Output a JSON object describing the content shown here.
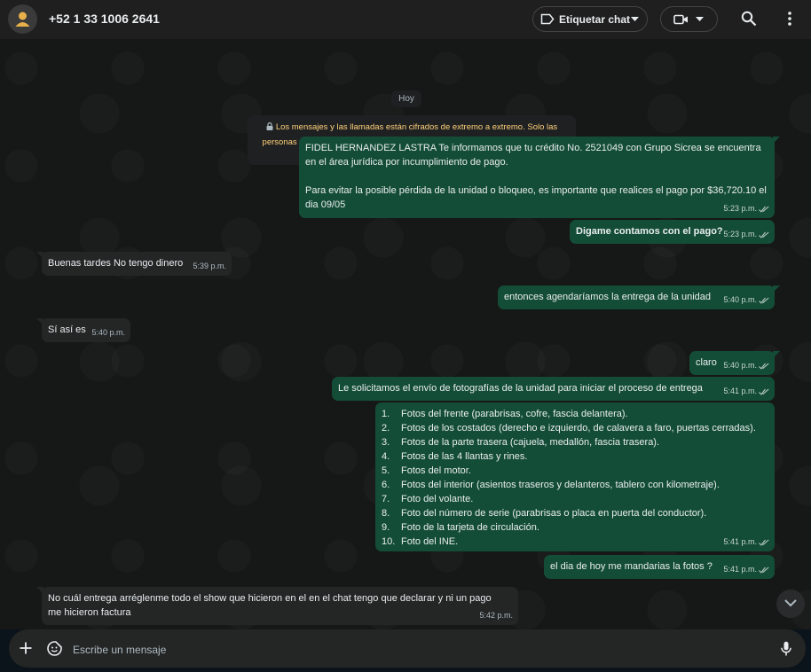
{
  "header": {
    "contact_name": "+52 1 33 1006 2641",
    "label_chat": "Etiquetar chat"
  },
  "chat": {
    "date_chip": "Hoy",
    "encryption_notice": "Los mensajes y las llamadas están cifrados de extremo a extremo. Solo las personas en este chat pueden leerlos, escucharlos o compartirlos. Haz clic para obtener más información.",
    "messages": [
      {
        "direction": "out",
        "paragraphs": [
          "FIDEL HERNANDEZ LASTRA  Te informamos que tu crédito No. 2521049 con Grupo Sicrea se encuentra en el área jurídica por incumplimiento de pago.",
          "Para evitar la posible pérdida de la unidad o bloqueo, es importante que realices el pago  por $36,720.10  el dia 09/05"
        ],
        "time": "5:23 p.m."
      },
      {
        "direction": "out",
        "text": "Digame contamos con el pago?",
        "time": "5:23 p.m."
      },
      {
        "direction": "in",
        "text": "Buenas tardes No tengo dinero",
        "time": "5:39 p.m."
      },
      {
        "direction": "out",
        "text": "entonces agendaríamos la entrega de la unidad",
        "time": "5:40 p.m."
      },
      {
        "direction": "in",
        "text": "Sí así es",
        "time": "5:40 p.m."
      },
      {
        "direction": "out",
        "text": "claro",
        "time": "5:40 p.m."
      },
      {
        "direction": "out",
        "text": "Le solicitamos el envío de fotografías de la unidad para iniciar el proceso de entrega",
        "time": "5:41 p.m."
      },
      {
        "direction": "out",
        "list": [
          {
            "n": "1.",
            "text": "Fotos del frente (parabrisas, cofre, fascia delantera)."
          },
          {
            "n": "2.",
            "text": "Fotos de los costados (derecho e izquierdo, de calavera a faro, puertas cerradas)."
          },
          {
            "n": "3.",
            "text": "Fotos de la parte trasera (cajuela, medallón, fascia trasera)."
          },
          {
            "n": "4.",
            "text": "Fotos de las 4 llantas y rines."
          },
          {
            "n": "5.",
            "text": "Fotos del motor."
          },
          {
            "n": "6.",
            "text": "Fotos del interior (asientos traseros y delanteros, tablero con kilometraje)."
          },
          {
            "n": "7.",
            "text": "Foto del volante."
          },
          {
            "n": "8.",
            "text": "Foto del número de serie (parabrisas o placa en puerta del conductor)."
          },
          {
            "n": "9.",
            "text": "Foto de la tarjeta de circulación."
          },
          {
            "n": "10.",
            "text": "Foto del INE."
          }
        ],
        "time": "5:41 p.m."
      },
      {
        "direction": "out",
        "text": "el dia de hoy me mandarias la fotos ?",
        "time": "5:41 p.m."
      },
      {
        "direction": "in",
        "text": "No cuál entrega arréglenme todo el show que hicieron en el en el chat tengo que declarar y ni un pago me hicieron factura",
        "time": "5:42 p.m."
      }
    ]
  },
  "composer": {
    "placeholder": "Escribe un mensaje"
  },
  "colors": {
    "outgoing_bubble": "#144d37",
    "incoming_bubble": "#242626",
    "encryption_text": "#ffd279"
  }
}
